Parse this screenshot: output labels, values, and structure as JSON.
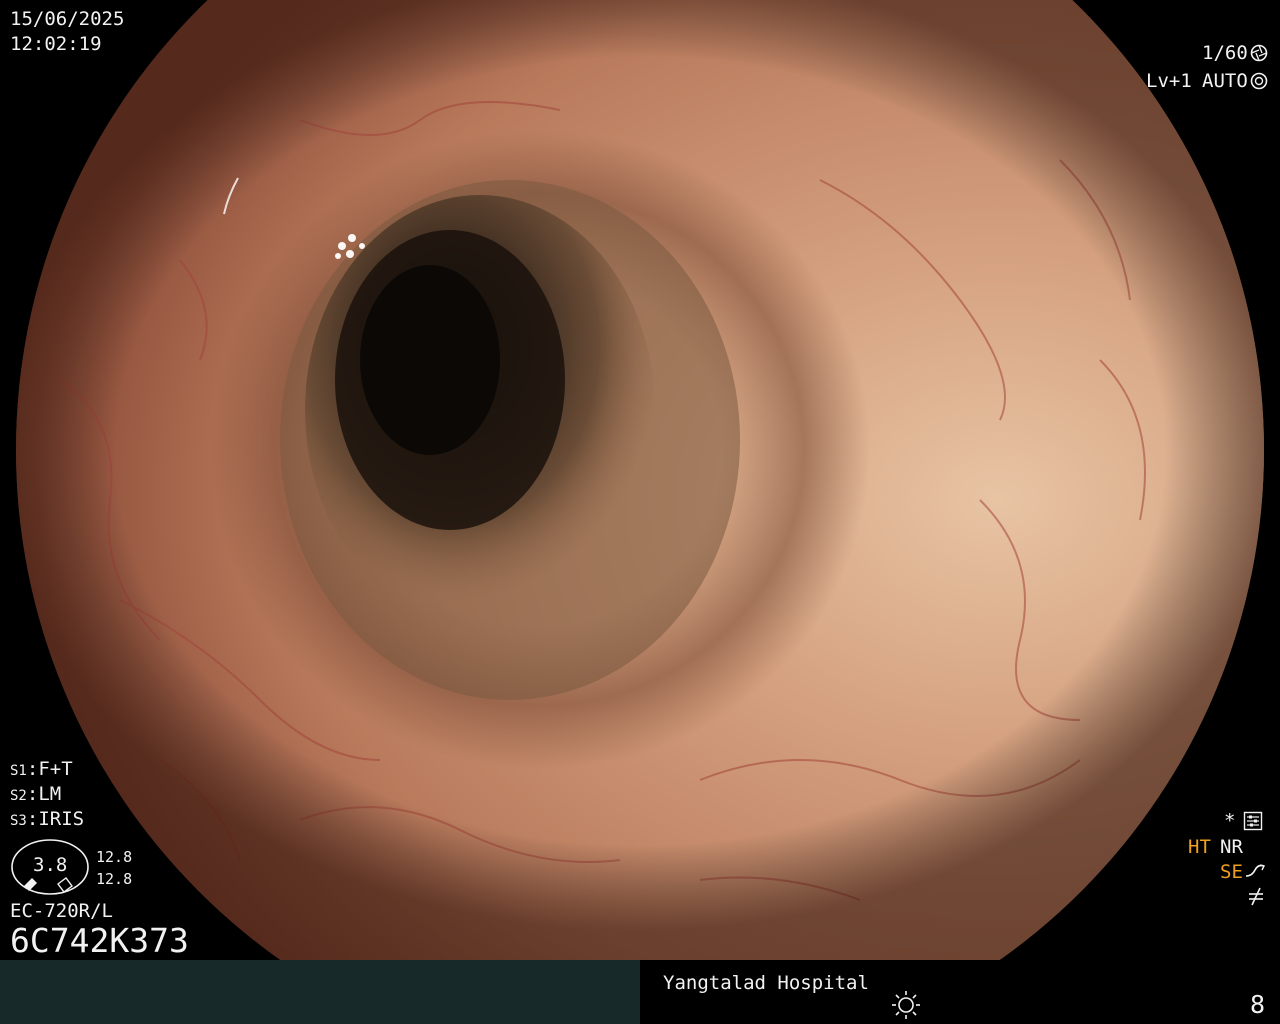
{
  "header": {
    "date": "15/06/2025",
    "time": "12:02:19"
  },
  "exposure": {
    "shutter": "1/60",
    "level": "Lv+1",
    "mode": "AUTO"
  },
  "switches": [
    {
      "prefix": "S1",
      "value": "F+T"
    },
    {
      "prefix": "S2",
      "value": "LM"
    },
    {
      "prefix": "S3",
      "value": "IRIS"
    }
  ],
  "gauge": {
    "value": "3.8",
    "readout_top": "12.8",
    "readout_bottom": "12.8"
  },
  "scope": {
    "model": "EC-720R/L",
    "serial": "6C742K373"
  },
  "status": {
    "ht": "HT",
    "nr": "NR",
    "se": "SE"
  },
  "footer": {
    "hospital": "Yangtalad Hospital",
    "page": "8"
  },
  "colors": {
    "highlight": "#f0a020",
    "text": "#f2f2f2",
    "footer_bg": "#18292a"
  }
}
